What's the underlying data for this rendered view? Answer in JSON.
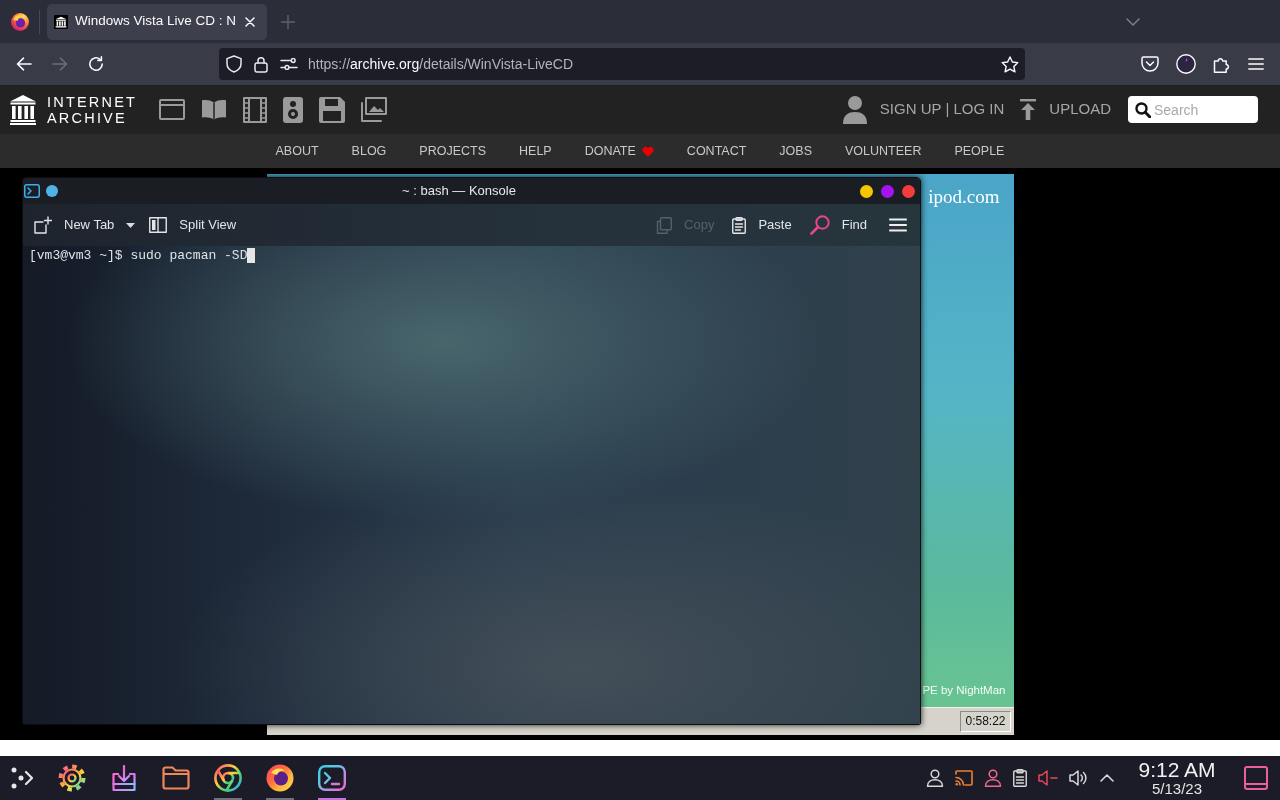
{
  "browser": {
    "tabs": [
      {
        "title": "Windows Vista Live CD : N",
        "selected": true
      }
    ],
    "nav_buttons": [
      {
        "kind": "back",
        "disabled": false
      },
      {
        "kind": "forward",
        "disabled": true
      },
      {
        "kind": "reload",
        "disabled": false
      }
    ],
    "address": {
      "url": "https://**archive.org**/details/WinVista-LiveCD"
    },
    "toolbar": [
      {
        "kind": "pocket"
      },
      {
        "kind": "account"
      },
      {
        "kind": "extensions"
      },
      {
        "kind": "menu"
      }
    ]
  },
  "site": {
    "logo": {
      "line_1": "INTERNET",
      "line_2": "ARCHIVE"
    },
    "media": [
      {
        "kind": "web"
      },
      {
        "kind": "texts"
      },
      {
        "kind": "video"
      },
      {
        "kind": "audio"
      },
      {
        "kind": "software"
      },
      {
        "kind": "images"
      }
    ],
    "account_links": [
      "SIGN UP",
      "LOG IN"
    ],
    "account_separator": "|",
    "upload": "UPLOAD",
    "search": {
      "placeholder": "Search"
    },
    "menu": [
      {
        "label": "ABOUT",
        "kind": "plain"
      },
      {
        "label": "BLOG",
        "kind": "plain"
      },
      {
        "label": "PROJECTS",
        "kind": "plain"
      },
      {
        "label": "HELP",
        "kind": "plain"
      },
      {
        "label": "DONATE",
        "kind": "heart"
      },
      {
        "label": "CONTACT",
        "kind": "plain"
      },
      {
        "label": "JOBS",
        "kind": "plain"
      },
      {
        "label": "VOLUNTEER",
        "kind": "plain"
      },
      {
        "label": "PEOPLE",
        "kind": "plain"
      }
    ]
  },
  "emulator": {
    "banner": "ipod.com",
    "credit": "PE by NightMan",
    "clock": "0:58:22"
  },
  "konsole": {
    "title": "~ : bash — Konsole",
    "toolbar_start": [
      {
        "kind": "new-tab",
        "label": "New Tab",
        "dropdown": true,
        "disabled": false
      },
      {
        "kind": "split-view",
        "label": "Split View",
        "dropdown": false,
        "disabled": false
      }
    ],
    "toolbar_end": [
      {
        "kind": "copy",
        "label": "Copy",
        "dropdown": false,
        "disabled": true
      },
      {
        "kind": "paste",
        "label": "Paste",
        "dropdown": false,
        "disabled": false
      },
      {
        "kind": "find",
        "label": "Find",
        "dropdown": false,
        "disabled": false
      }
    ],
    "lines": [
      {
        "text": "[vm3@vm3 ~]$ sudo pacman -SD",
        "cursor": true
      }
    ]
  },
  "taskbar": {
    "apps": [
      {
        "kind": "launcher",
        "running": false,
        "active": false
      },
      {
        "kind": "settings",
        "running": false,
        "active": false
      },
      {
        "kind": "download",
        "running": false,
        "active": false
      },
      {
        "kind": "files",
        "running": false,
        "active": false
      },
      {
        "kind": "ring",
        "running": true,
        "active": false
      },
      {
        "kind": "swirl",
        "running": true,
        "active": false
      },
      {
        "kind": "terminal",
        "running": true,
        "active": true
      }
    ],
    "tray": [
      {
        "kind": "person"
      },
      {
        "kind": "cast"
      },
      {
        "kind": "person-accent"
      },
      {
        "kind": "clipboard"
      },
      {
        "kind": "muted-speaker"
      },
      {
        "kind": "speaker"
      },
      {
        "kind": "expand"
      }
    ],
    "time": "9:12 AM",
    "date": "5/13/23"
  }
}
